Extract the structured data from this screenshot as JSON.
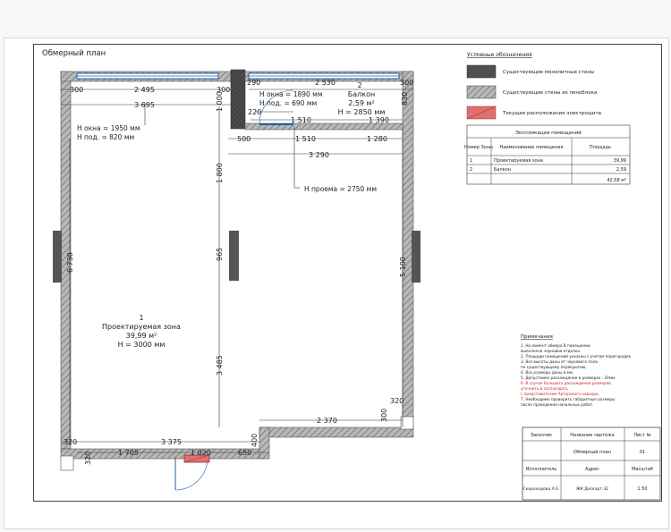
{
  "plan": {
    "title": "Обмерный план",
    "room1": {
      "number": "1",
      "name": "Проектируемая зона",
      "area": "39,99 м²",
      "height": "Н = 3000 мм"
    },
    "room2": {
      "number": "2",
      "name": "Балкон",
      "area": "2,59 м²",
      "height": "Н = 2850 мм"
    },
    "window_left": {
      "h": "Н окна = 1950 мм",
      "sill": "Н под. = 820 мм"
    },
    "window_balcony": {
      "h": "Н окна = 1890 мм",
      "sill": "Н под. = 690 мм"
    },
    "opening": "Н проема = 2750 мм",
    "dims": {
      "d300a": "300",
      "d2495": "2 495",
      "d300b": "300",
      "d290": "290",
      "d2530": "2 530",
      "d300c": "300",
      "d3695": "3 695",
      "d1000": "1 000",
      "d220": "220",
      "d830": "830",
      "d1510a": "1 510",
      "d1390": "1 390",
      "d500": "500",
      "d1510b": "1 510",
      "d1280": "1 280",
      "d3290": "3 290",
      "d1800": "1 800",
      "d6730": "6 730",
      "d965": "965",
      "d5100": "5 100",
      "d3485": "3 485",
      "d320a": "320",
      "d2370": "2 370",
      "d300d": "300",
      "d320b": "320",
      "d3375": "3 375",
      "d320c": "320",
      "d1705": "1 705",
      "d1020": "1 020",
      "d650": "650",
      "d400": "400"
    }
  },
  "legend": {
    "title": "Условные обозначения",
    "items": [
      {
        "label": "Существующие монолитные стены",
        "color": "#505050"
      },
      {
        "label": "Существующие стены из пеноблока",
        "color": "#8c8c8c"
      },
      {
        "label": "Текущее расположение электрощита",
        "color": "#e07070"
      }
    ]
  },
  "explication": {
    "title": "Экспликация помещений",
    "headers": [
      "Номер Зоны",
      "Наименование помещения",
      "Площадь"
    ],
    "rows": [
      [
        "1",
        "Проектируемая зона",
        "39,99"
      ],
      [
        "2",
        "Балкон",
        "2,59"
      ],
      [
        "",
        "",
        "42,58 м²"
      ]
    ]
  },
  "notes": {
    "title": "Примечания",
    "lines": [
      "1. На момент обмера В помещении",
      "выполнена черновая отделка.",
      "2. Площади помещений указаны с учетом перегородок",
      "3. Все высоты даны от чернового пола",
      "по существующему перекрытию.",
      "4. Все размеры даны в мм.",
      "5. Допустимое расхождение в размерах - 20мм.",
      "6. В случае большего расхождения размеров",
      "уточнить и согласовать",
      "с представителем Авторского надзора.",
      "7. Необходимо проверить габаритные размеры",
      "после проведения начальных работ."
    ]
  },
  "stamp": {
    "headers": [
      "Заказчик",
      "Название чертежа",
      "Лист №"
    ],
    "values": [
      "",
      "Обмерный план",
      "01"
    ],
    "headers2": [
      "Исполнитель",
      "Адрес",
      "Масштаб"
    ],
    "values2": [
      "Скороходова А.Е.",
      "ЖК Дескарт.32",
      "1:50"
    ]
  }
}
